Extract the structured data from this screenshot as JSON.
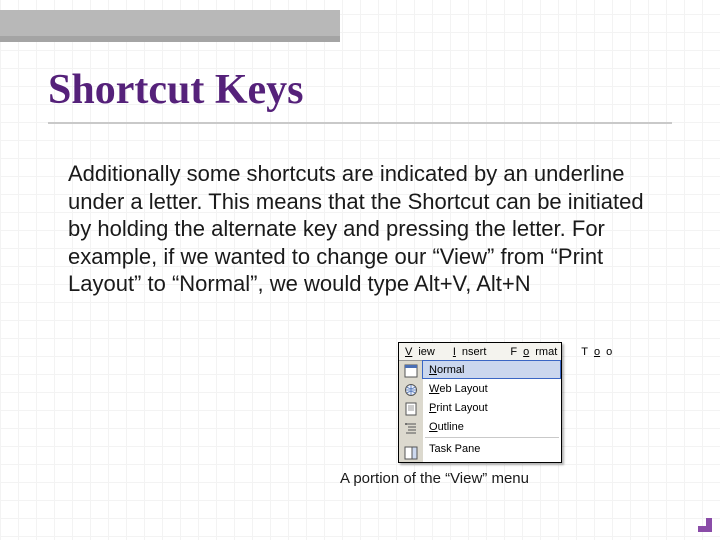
{
  "slide": {
    "title": "Shortcut Keys",
    "body": "Additionally some shortcuts are indicated by an underline under a letter.  This means that the Shortcut can be initiated by holding the alternate key and pressing the letter.  For example, if we wanted to change our “View” from “Print Layout” to “Normal”, we would type Alt+V, Alt+N",
    "caption": "A portion of the “View” menu"
  },
  "menu": {
    "bar": {
      "view_pre": "V",
      "view_post": "iew",
      "insert_pre": "I",
      "insert_post": "nsert",
      "format_pre": "F",
      "format_mid": "o",
      "format_post": "rmat",
      "tools_pre": "T",
      "tools_mid": "o",
      "tools_post": "o"
    },
    "items": {
      "normal_pre": "N",
      "normal_post": "ormal",
      "web_pre": "W",
      "web_post": "eb Layout",
      "print_pre": "P",
      "print_post": "rint Layout",
      "outline_pre": "O",
      "outline_post": "utline",
      "taskpane": "Task Pane"
    }
  }
}
